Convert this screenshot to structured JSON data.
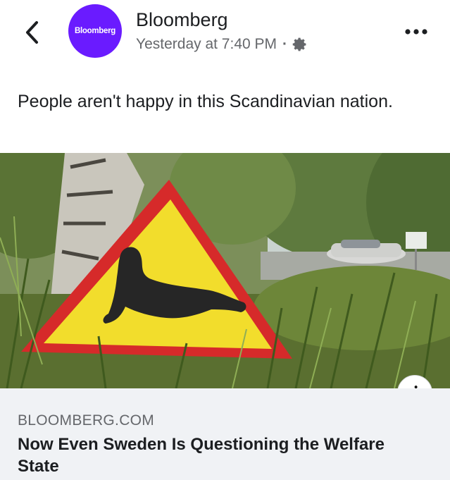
{
  "post": {
    "page_name": "Bloomberg",
    "avatar_text": "Bloomberg",
    "timestamp": "Yesterday at 7:40 PM",
    "separator": "·",
    "privacy_icon": "gear-icon",
    "caption": "People aren't happy in this Scandinavian nation.",
    "brand_color": "#6a1bff"
  },
  "image": {
    "description_icon": "info-icon",
    "info_label": "i"
  },
  "link_preview": {
    "domain": "BLOOMBERG.COM",
    "headline": "Now Even Sweden Is Questioning the Welfare State"
  },
  "icons": {
    "back": "chevron-left-icon",
    "more": "more-horizontal-icon"
  }
}
